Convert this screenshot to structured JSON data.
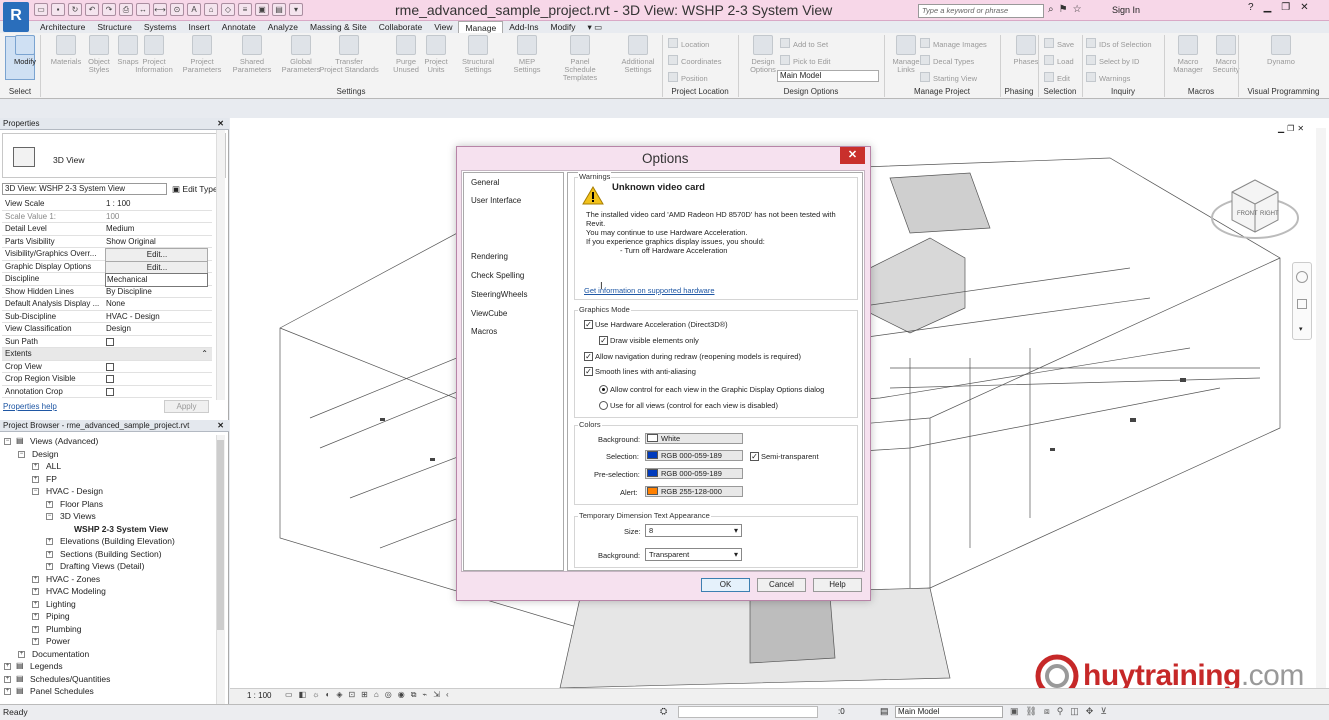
{
  "app": {
    "logo": "R",
    "title": "rme_advanced_sample_project.rvt - 3D View: WSHP 2-3 System View",
    "search_placeholder": "Type a keyword or phrase",
    "sign_in": "Sign In",
    "accent": "#2a6ebb"
  },
  "tabs": [
    "Architecture",
    "Structure",
    "Systems",
    "Insert",
    "Annotate",
    "Analyze",
    "Massing & Site",
    "Collaborate",
    "View",
    "Manage",
    "Add-Ins",
    "Modify"
  ],
  "active_tab": "Manage",
  "ribbon": {
    "buttons": [
      {
        "label": "Modify",
        "label2": ""
      },
      {
        "label": "Materials",
        "label2": ""
      },
      {
        "label": "Object",
        "label2": "Styles"
      },
      {
        "label": "Snaps",
        "label2": ""
      },
      {
        "label": "Project",
        "label2": "Information"
      },
      {
        "label": "Project",
        "label2": "Parameters"
      },
      {
        "label": "Shared",
        "label2": "Parameters"
      },
      {
        "label": "Global",
        "label2": "Parameters"
      },
      {
        "label": "Transfer",
        "label2": "Project Standards"
      },
      {
        "label": "Purge",
        "label2": "Unused"
      },
      {
        "label": "Project",
        "label2": "Units"
      },
      {
        "label": "Structural",
        "label2": "Settings"
      },
      {
        "label": "MEP",
        "label2": "Settings"
      },
      {
        "label": "Panel Schedule",
        "label2": "Templates"
      },
      {
        "label": "Additional",
        "label2": "Settings"
      },
      {
        "label": "Design",
        "label2": "Options"
      },
      {
        "label": "Manage",
        "label2": "Links"
      },
      {
        "label": "Phases",
        "label2": ""
      },
      {
        "label": "Macro",
        "label2": "Manager"
      },
      {
        "label": "Macro",
        "label2": "Security"
      },
      {
        "label": "Dynamo",
        "label2": ""
      }
    ],
    "small": [
      "Location",
      "Coordinates",
      "Position",
      "Add to Set",
      "Pick to Edit",
      "Manage Images",
      "Decal Types",
      "Starting View",
      "Save",
      "Load",
      "Edit",
      "IDs of Selection",
      "Select by ID",
      "Warnings"
    ],
    "design_option_value": "Main Model",
    "groups": [
      "Select",
      "Settings",
      "Project Location",
      "Design Options",
      "Manage Project",
      "Phasing",
      "Selection",
      "Inquiry",
      "Macros",
      "Visual Programming"
    ]
  },
  "properties": {
    "title": "Properties",
    "type_name": "3D View",
    "view_selector": "3D View: WSHP 2-3 System View",
    "edit_type": "Edit Type",
    "rows": [
      {
        "k": "View Scale",
        "v": "1 : 100"
      },
      {
        "k": "Scale Value    1:",
        "v": "100"
      },
      {
        "k": "Detail Level",
        "v": "Medium"
      },
      {
        "k": "Parts Visibility",
        "v": "Show Original"
      },
      {
        "k": "Visibility/Graphics Overr...",
        "v": "Edit..."
      },
      {
        "k": "Graphic Display Options",
        "v": "Edit..."
      },
      {
        "k": "Discipline",
        "v": "Mechanical"
      },
      {
        "k": "Show Hidden Lines",
        "v": "By Discipline"
      },
      {
        "k": "Default Analysis Display ...",
        "v": "None"
      },
      {
        "k": "Sub-Discipline",
        "v": "HVAC - Design"
      },
      {
        "k": "View Classification",
        "v": "Design"
      },
      {
        "k": "Sun Path",
        "v": ""
      },
      {
        "k": "Extents",
        "v": ""
      },
      {
        "k": "Crop View",
        "v": ""
      },
      {
        "k": "Crop Region Visible",
        "v": ""
      },
      {
        "k": "Annotation Crop",
        "v": ""
      }
    ],
    "help": "Properties help",
    "apply": "Apply"
  },
  "browser": {
    "title": "Project Browser - rme_advanced_sample_project.rvt",
    "nodes": [
      {
        "t": "Views (Advanced)",
        "lvl": 0,
        "pm": "−"
      },
      {
        "t": "Design",
        "lvl": 1,
        "pm": "−"
      },
      {
        "t": "ALL",
        "lvl": 2,
        "pm": "+"
      },
      {
        "t": "FP",
        "lvl": 2,
        "pm": "+"
      },
      {
        "t": "HVAC - Design",
        "lvl": 2,
        "pm": "−"
      },
      {
        "t": "Floor Plans",
        "lvl": 3,
        "pm": "+"
      },
      {
        "t": "3D Views",
        "lvl": 3,
        "pm": "−"
      },
      {
        "t": "WSHP 2-3 System View",
        "lvl": 4,
        "pm": "",
        "bold": true
      },
      {
        "t": "Elevations (Building Elevation)",
        "lvl": 3,
        "pm": "+"
      },
      {
        "t": "Sections (Building Section)",
        "lvl": 3,
        "pm": "+"
      },
      {
        "t": "Drafting Views (Detail)",
        "lvl": 3,
        "pm": "+"
      },
      {
        "t": "HVAC - Zones",
        "lvl": 2,
        "pm": "+"
      },
      {
        "t": "HVAC Modeling",
        "lvl": 2,
        "pm": "+"
      },
      {
        "t": "Lighting",
        "lvl": 2,
        "pm": "+"
      },
      {
        "t": "Piping",
        "lvl": 2,
        "pm": "+"
      },
      {
        "t": "Plumbing",
        "lvl": 2,
        "pm": "+"
      },
      {
        "t": "Power",
        "lvl": 2,
        "pm": "+"
      },
      {
        "t": "Documentation",
        "lvl": 1,
        "pm": "+"
      },
      {
        "t": "Legends",
        "lvl": 0,
        "pm": "+"
      },
      {
        "t": "Schedules/Quantities",
        "lvl": 0,
        "pm": "+"
      },
      {
        "t": "Panel Schedules",
        "lvl": 0,
        "pm": "+"
      }
    ]
  },
  "viewcube": {
    "front": "FRONT",
    "right": "RIGHT"
  },
  "viewbar": {
    "scale": "1 : 100"
  },
  "status": {
    "ready": "Ready",
    "zero": ":0",
    "model": "Main Model"
  },
  "watermark": {
    "brand": "huytraining",
    "suffix": ".com",
    "color": "#c62828"
  },
  "dialog": {
    "title": "Options",
    "close": "✕",
    "nav": [
      "General",
      "User Interface",
      "Rendering",
      "Check Spelling",
      "SteeringWheels",
      "ViewCube",
      "Macros"
    ],
    "warnings_title": "Warnings",
    "warning_heading": "Unknown video card",
    "warning_lines": [
      "The installed video card 'AMD Radeon HD 8570D' has not been tested with",
      "Revit.",
      "You may continue to use Hardware Acceleration.",
      "If you experience graphics display issues, you should:",
      "- Turn off Hardware Acceleration"
    ],
    "warning_link": "Get information on supported hardware",
    "graphics_title": "Graphics Mode",
    "graphics": [
      {
        "label": "Use Hardware Acceleration (Direct3D®)",
        "checked": true
      },
      {
        "label": "Draw visible elements only",
        "checked": true
      },
      {
        "label": "Allow navigation during redraw (reopening models is required)",
        "checked": true
      },
      {
        "label": "Smooth lines with anti-aliasing",
        "checked": true
      }
    ],
    "radios": [
      {
        "label": "Allow control for each view in the Graphic Display Options dialog",
        "selected": true
      },
      {
        "label": "Use for all views (control for each view is disabled)",
        "selected": false
      }
    ],
    "colors_title": "Colors",
    "colors": [
      {
        "label": "Background:",
        "value": "White",
        "hex": "#ffffff"
      },
      {
        "label": "Selection:",
        "value": "RGB 000-059-189",
        "hex": "#003bbd"
      },
      {
        "label": "Pre-selection:",
        "value": "RGB 000-059-189",
        "hex": "#003bbd"
      },
      {
        "label": "Alert:",
        "value": "RGB 255-128-000",
        "hex": "#ff8000"
      }
    ],
    "semi_transparent": "Semi-transparent",
    "tempdim_title": "Temporary Dimension Text Appearance",
    "size_label": "Size:",
    "size_value": "8",
    "bg_label": "Background:",
    "bg_value": "Transparent",
    "ok": "OK",
    "cancel": "Cancel",
    "help": "Help"
  }
}
